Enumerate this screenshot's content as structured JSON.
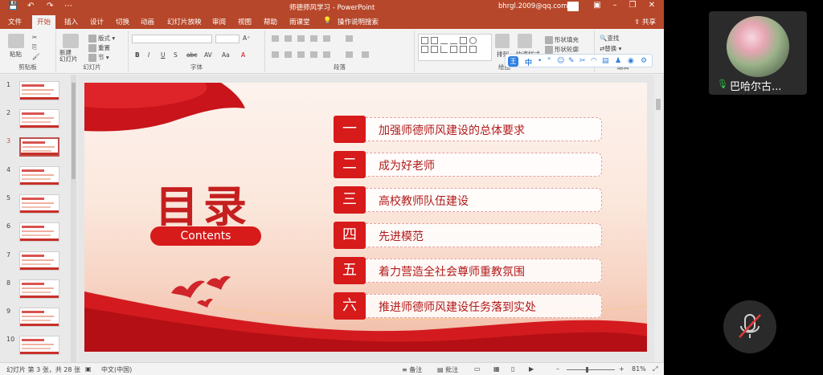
{
  "window": {
    "doc_title": "师德师风学习  -  PowerPoint",
    "user_email": "bhrgl.2009@qq.com",
    "share_label": "共享"
  },
  "tabs": [
    "文件",
    "开始",
    "插入",
    "设计",
    "切换",
    "动画",
    "幻灯片放映",
    "审阅",
    "视图",
    "帮助",
    "雨课堂",
    "操作说明搜索"
  ],
  "active_tab": "开始",
  "ribbon": {
    "groups": [
      "剪贴板",
      "幻灯片",
      "字体",
      "段落",
      "绘图",
      "编辑"
    ],
    "paste": "粘贴",
    "new_slide": "新建\n幻灯片",
    "layout": "版式",
    "reset": "重置",
    "section": "节",
    "font_buttons": [
      "B",
      "I",
      "U",
      "S",
      "abc",
      "AV",
      "Aa",
      "A"
    ],
    "arrange": "排列",
    "quick_styles": "快速样式",
    "shape_fill": "形状填充",
    "shape_outline": "形状轮廓",
    "find": "查找",
    "replace": "替换"
  },
  "ime": {
    "logo": "王",
    "items": [
      "中",
      "•",
      "°",
      "☺",
      "✎",
      "✂",
      "◠",
      "▤",
      "♟",
      "◉",
      "⚙"
    ]
  },
  "thumbnails": {
    "numbers": [
      "1",
      "2",
      "3",
      "4",
      "5",
      "6",
      "7",
      "8",
      "9",
      "10"
    ],
    "selected": 3
  },
  "slide": {
    "title": "目录",
    "subtitle": "Contents",
    "toc": [
      {
        "num": "一",
        "text": "加强师德师风建设的总体要求"
      },
      {
        "num": "二",
        "text": "成为好老师"
      },
      {
        "num": "三",
        "text": "高校教师队伍建设"
      },
      {
        "num": "四",
        "text": "先进模范"
      },
      {
        "num": "五",
        "text": "着力营造全社会尊师重教氛围"
      },
      {
        "num": "六",
        "text": "推进师德师风建设任务落到实处"
      }
    ]
  },
  "statusbar": {
    "slide_info": "幻灯片 第 3 张，共 28 张",
    "language": "中文(中国)",
    "notes": "备注",
    "comments": "批注",
    "zoom": "81%",
    "zoom_level": 0.81
  },
  "meeting": {
    "participant_name": "巴哈尔古...",
    "mic_muted": true
  },
  "colors": {
    "ppt_accent": "#b7472a",
    "slide_red": "#d71a1a",
    "mic_green": "#34c04a"
  }
}
